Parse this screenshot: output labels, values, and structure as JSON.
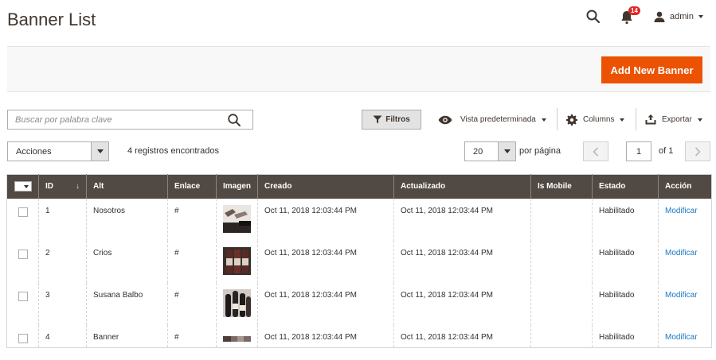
{
  "page": {
    "title": "Banner List"
  },
  "header": {
    "notification_count": "14",
    "user_name": "admin"
  },
  "actions": {
    "add_button": "Add New Banner"
  },
  "toolbar": {
    "search_placeholder": "Buscar por palabra clave",
    "filters_label": "Filtros",
    "view_label": "Vista predeterminada",
    "columns_label": "Columns",
    "export_label": "Exportar"
  },
  "listing": {
    "mass_action_label": "Acciones",
    "records_found": "4 registros encontrados",
    "per_page_value": "20",
    "per_page_label": "por página",
    "current_page": "1",
    "total_pages": "of 1"
  },
  "grid": {
    "columns": [
      "ID",
      "Alt",
      "Enlace",
      "Imagen",
      "Creado",
      "Actualizado",
      "Is Mobile",
      "Estado",
      "Acción"
    ],
    "rows": [
      {
        "id": "1",
        "alt": "Nosotros",
        "link": "#",
        "created": "Oct 11, 2018 12:03:44 PM",
        "updated": "Oct 11, 2018 12:03:44 PM",
        "is_mobile": "",
        "status": "Habilitado",
        "action": "Modificar"
      },
      {
        "id": "2",
        "alt": "Crios",
        "link": "#",
        "created": "Oct 11, 2018 12:03:44 PM",
        "updated": "Oct 11, 2018 12:03:44 PM",
        "is_mobile": "",
        "status": "Habilitado",
        "action": "Modificar"
      },
      {
        "id": "3",
        "alt": "Susana Balbo",
        "link": "#",
        "created": "Oct 11, 2018 12:03:44 PM",
        "updated": "Oct 11, 2018 12:03:44 PM",
        "is_mobile": "",
        "status": "Habilitado",
        "action": "Modificar"
      },
      {
        "id": "4",
        "alt": "Banner",
        "link": "#",
        "created": "Oct 11, 2018 12:03:44 PM",
        "updated": "Oct 11, 2018 12:03:44 PM",
        "is_mobile": "",
        "status": "Habilitado",
        "action": "Modificar"
      }
    ]
  },
  "colors": {
    "accent": "#eb5202",
    "header_bg": "#514943",
    "link": "#1979c3",
    "badge": "#e22626"
  },
  "icons": [
    "search-icon",
    "bell-icon",
    "user-icon",
    "filter-icon",
    "eye-icon",
    "gear-icon",
    "export-icon",
    "chevron-left-icon",
    "chevron-right-icon"
  ]
}
